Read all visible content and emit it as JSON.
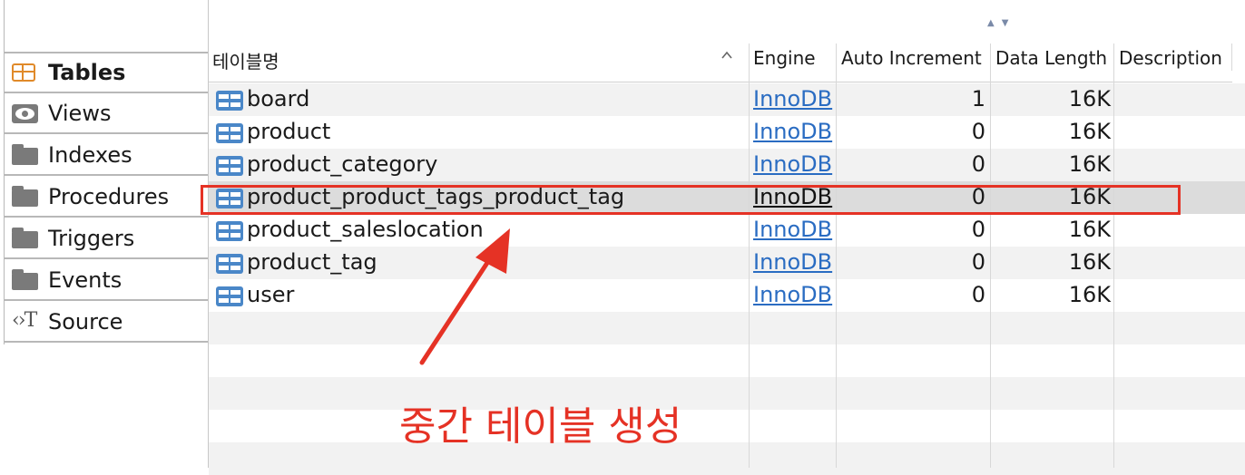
{
  "sidebar": {
    "items": [
      {
        "label": "Tables",
        "icon": "table-icon",
        "active": true
      },
      {
        "label": "Views",
        "icon": "eye-icon",
        "active": false
      },
      {
        "label": "Indexes",
        "icon": "folder-icon",
        "active": false
      },
      {
        "label": "Procedures",
        "icon": "folder-icon",
        "active": false
      },
      {
        "label": "Triggers",
        "icon": "folder-icon",
        "active": false
      },
      {
        "label": "Events",
        "icon": "folder-icon",
        "active": false
      },
      {
        "label": "Source",
        "icon": "source-icon",
        "active": false
      }
    ]
  },
  "table": {
    "headers": {
      "name": "테이블명",
      "engine": "Engine",
      "auto_increment": "Auto Increment",
      "data_length": "Data Length",
      "description": "Description"
    },
    "rows": [
      {
        "name": "board",
        "engine": "InnoDB",
        "auto_increment": "1",
        "data_length": "16K",
        "selected": false
      },
      {
        "name": "product",
        "engine": "InnoDB",
        "auto_increment": "0",
        "data_length": "16K",
        "selected": false
      },
      {
        "name": "product_category",
        "engine": "InnoDB",
        "auto_increment": "0",
        "data_length": "16K",
        "selected": false
      },
      {
        "name": "product_product_tags_product_tag",
        "engine": "InnoDB",
        "auto_increment": "0",
        "data_length": "16K",
        "selected": true
      },
      {
        "name": "product_saleslocation",
        "engine": "InnoDB",
        "auto_increment": "0",
        "data_length": "16K",
        "selected": false
      },
      {
        "name": "product_tag",
        "engine": "InnoDB",
        "auto_increment": "0",
        "data_length": "16K",
        "selected": false
      },
      {
        "name": "user",
        "engine": "InnoDB",
        "auto_increment": "0",
        "data_length": "16K",
        "selected": false
      }
    ]
  },
  "annotation": {
    "text": "중간 테이블 생성",
    "color": "#e53225"
  },
  "colors": {
    "link": "#2a6cc2",
    "table_icon": "#4a87c8",
    "active_icon": "#e08a2a"
  }
}
